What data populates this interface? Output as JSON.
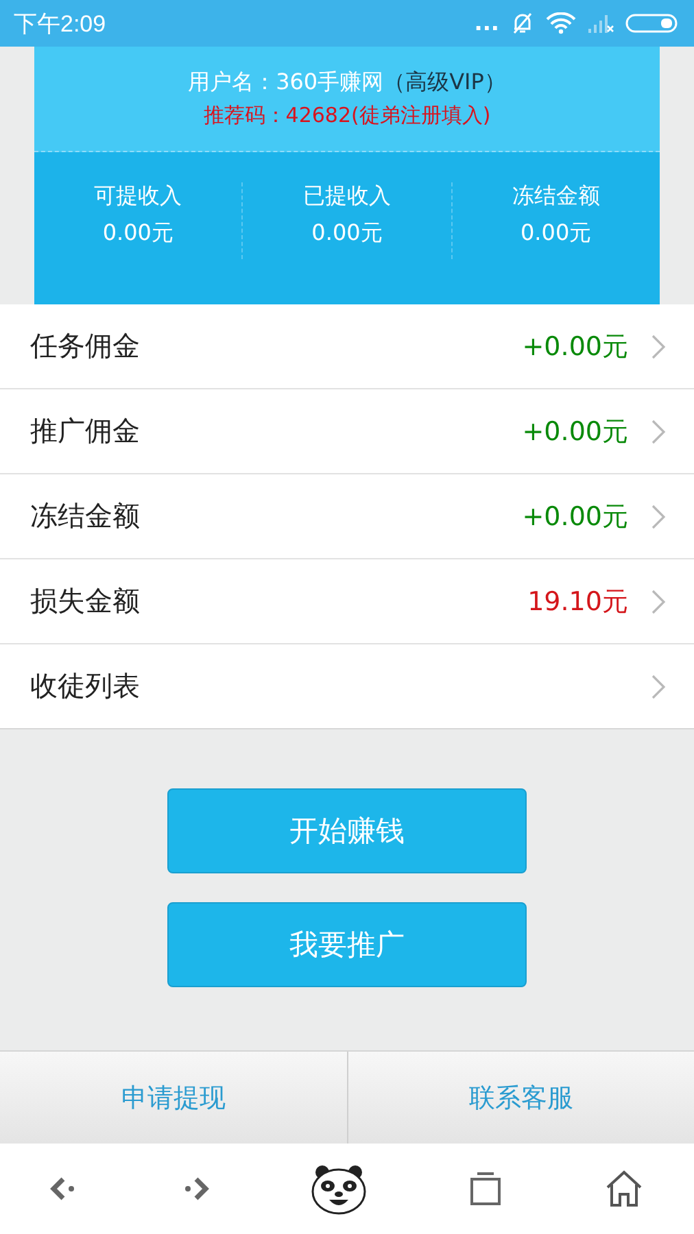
{
  "status_bar": {
    "time": "下午2:09",
    "dots": "..."
  },
  "header": {
    "username": "用户名：360手赚网",
    "vip": "（高级VIP）",
    "referral": "推荐码：42682(徒弟注册填入)"
  },
  "stats": [
    {
      "label": "可提收入",
      "value": "0.00元"
    },
    {
      "label": "已提收入",
      "value": "0.00元"
    },
    {
      "label": "冻结金额",
      "value": "0.00元"
    }
  ],
  "rows": [
    {
      "label": "任务佣金",
      "amount": "+0.00元",
      "color": "#0a8a0a"
    },
    {
      "label": "推广佣金",
      "amount": "+0.00元",
      "color": "#0a8a0a"
    },
    {
      "label": "冻结金额",
      "amount": "+0.00元",
      "color": "#0a8a0a"
    },
    {
      "label": "损失金额",
      "amount": "19.10元",
      "color": "#d4161b"
    },
    {
      "label": "收徒列表"
    }
  ],
  "buttons": [
    "开始赚钱",
    "我要推广"
  ],
  "bottom_actions": [
    "申请提现",
    "联系客服"
  ]
}
